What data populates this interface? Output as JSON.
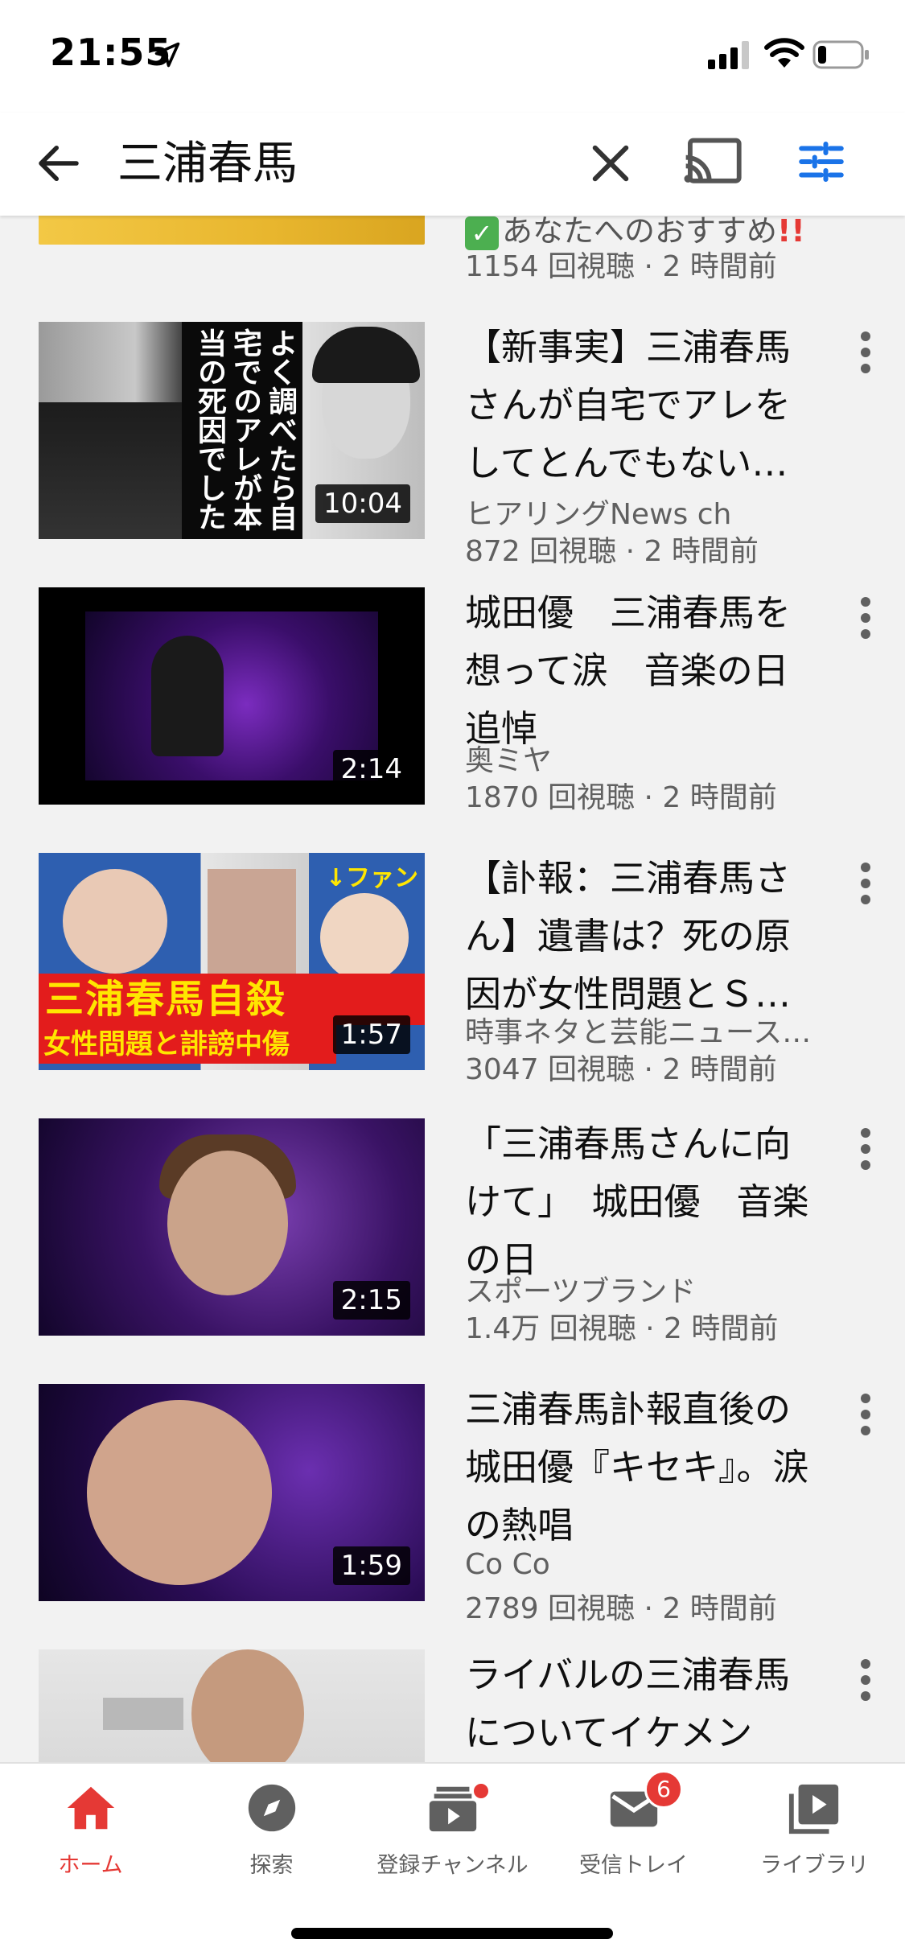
{
  "status_bar": {
    "time": "21:55"
  },
  "search": {
    "query": "三浦春馬"
  },
  "partial_result": {
    "title_text": "あなたへのおすすめ",
    "meta": "1154 回視聴 · 2 時間前"
  },
  "videos": [
    {
      "title": "【新事実】三浦春馬さんが自宅でアレをしてとんでもない…",
      "channel": "ヒアリングNews ch",
      "meta": "872 回視聴 · 2 時間前",
      "duration": "10:04",
      "thumb_text": "よく調べたら自宅でのアレが本当の死因でした"
    },
    {
      "title": "城田優　三浦春馬を想って涙　音楽の日追悼",
      "channel": "奥ミヤ",
      "meta": "1870 回視聴 · 2 時間前",
      "duration": "2:14"
    },
    {
      "title": "【訃報：三浦春馬さん】遺書は？死の原因が女性問題とＳ…",
      "channel": "時事ネタと芸能ニュース…",
      "meta": "3047 回視聴 · 2 時間前",
      "duration": "1:57",
      "thumb_text_1": "三浦春馬自殺",
      "thumb_text_2": "女性問題と誹謗中傷",
      "thumb_text_3": "↓ファン"
    },
    {
      "title": "「三浦春馬さんに向けて」　城田優　音楽の日",
      "channel": "スポーツブランド",
      "meta": "1.4万 回視聴 · 2 時間前",
      "duration": "2:15"
    },
    {
      "title": "三浦春馬訃報直後の城田優『キセキ』。涙の熱唱",
      "channel": "Co Co",
      "meta": "2789 回視聴 · 2 時間前",
      "duration": "1:59"
    },
    {
      "title": "ライバルの三浦春馬についてイケメン"
    }
  ],
  "bottom_nav": {
    "items": [
      {
        "label": "ホーム",
        "icon": "home-icon",
        "active": true
      },
      {
        "label": "探索",
        "icon": "explore-icon"
      },
      {
        "label": "登録チャンネル",
        "icon": "subscriptions-icon"
      },
      {
        "label": "受信トレイ",
        "icon": "inbox-icon",
        "badge": "6"
      },
      {
        "label": "ライブラリ",
        "icon": "library-icon"
      }
    ]
  },
  "colors": {
    "accent": "#e53935",
    "filter": "#1a73e8"
  }
}
